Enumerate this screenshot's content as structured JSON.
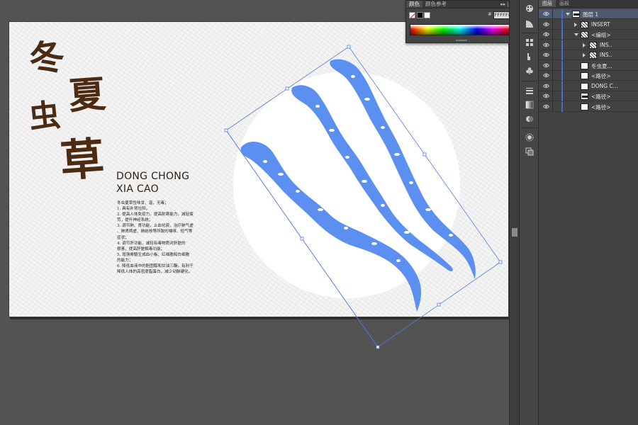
{
  "artboard": {
    "title_chars": [
      "冬",
      "夏",
      "虫",
      "草"
    ],
    "pinyin_line1": "DONG CHONG",
    "pinyin_line2": "XIA CAO",
    "description": [
      "冬虫夏草性味甘、温，无毒；",
      "1. 具有补肾壮阳，",
      "2. 提高人体免疫力，提高耐寒能力，减轻疲",
      "劳，提升神经系统；",
      "3. 调节肺、肾功能，止血化痰，治疗肺气虚",
      "、肺肾两虚、肺结核等所致的喘咳、短气等",
      "症状；",
      "4. 调节肝功能，减轻有毒物质对肝脏的",
      "损害，提高肝脏解毒功能；",
      "5. 增强骨髓生成血小板、红细胞和白细胞",
      "的能力；",
      "6. 降低血液中的胆固醇和甘油三酯，有利于",
      "降低人体的高密度脂蛋白，减少动脉硬化。"
    ]
  },
  "color_panel": {
    "tabs": [
      "颜色",
      "颜色参考"
    ],
    "hex_value": "FFFFFF",
    "hex_hash": "#",
    "menu_glyph": "▸▸ | ≡"
  },
  "layers_panel": {
    "tabs": [
      "图层",
      "画板"
    ],
    "rows": [
      {
        "name": "图层 1",
        "indent": 0,
        "expanded": true,
        "thumb": "dark",
        "selected": true
      },
      {
        "name": "INSERT",
        "indent": 1,
        "expanded": false,
        "thumb": "hatched",
        "selected": false
      },
      {
        "name": "<编组>",
        "indent": 1,
        "expanded": true,
        "thumb": "hatched",
        "selected": false
      },
      {
        "name": "INS..",
        "indent": 2,
        "expanded": false,
        "thumb": "hatched",
        "selected": false
      },
      {
        "name": "INS..",
        "indent": 2,
        "expanded": false,
        "thumb": "hatched",
        "selected": false
      },
      {
        "name": "冬虫夏...",
        "indent": 1,
        "expanded": null,
        "thumb": "plain",
        "selected": false
      },
      {
        "name": "<路径>",
        "indent": 1,
        "expanded": null,
        "thumb": "plain",
        "selected": false
      },
      {
        "name": "DONG C...",
        "indent": 1,
        "expanded": null,
        "thumb": "plain",
        "selected": false
      },
      {
        "name": "<路径>",
        "indent": 1,
        "expanded": null,
        "thumb": "dark",
        "selected": false
      },
      {
        "name": "<路径>",
        "indent": 1,
        "expanded": null,
        "thumb": "plain",
        "selected": false
      }
    ]
  },
  "colors": {
    "cordyceps_fill": "#5b8ff0",
    "selection_stroke": "#4f7be0",
    "title_brown": "#4d2a12"
  }
}
